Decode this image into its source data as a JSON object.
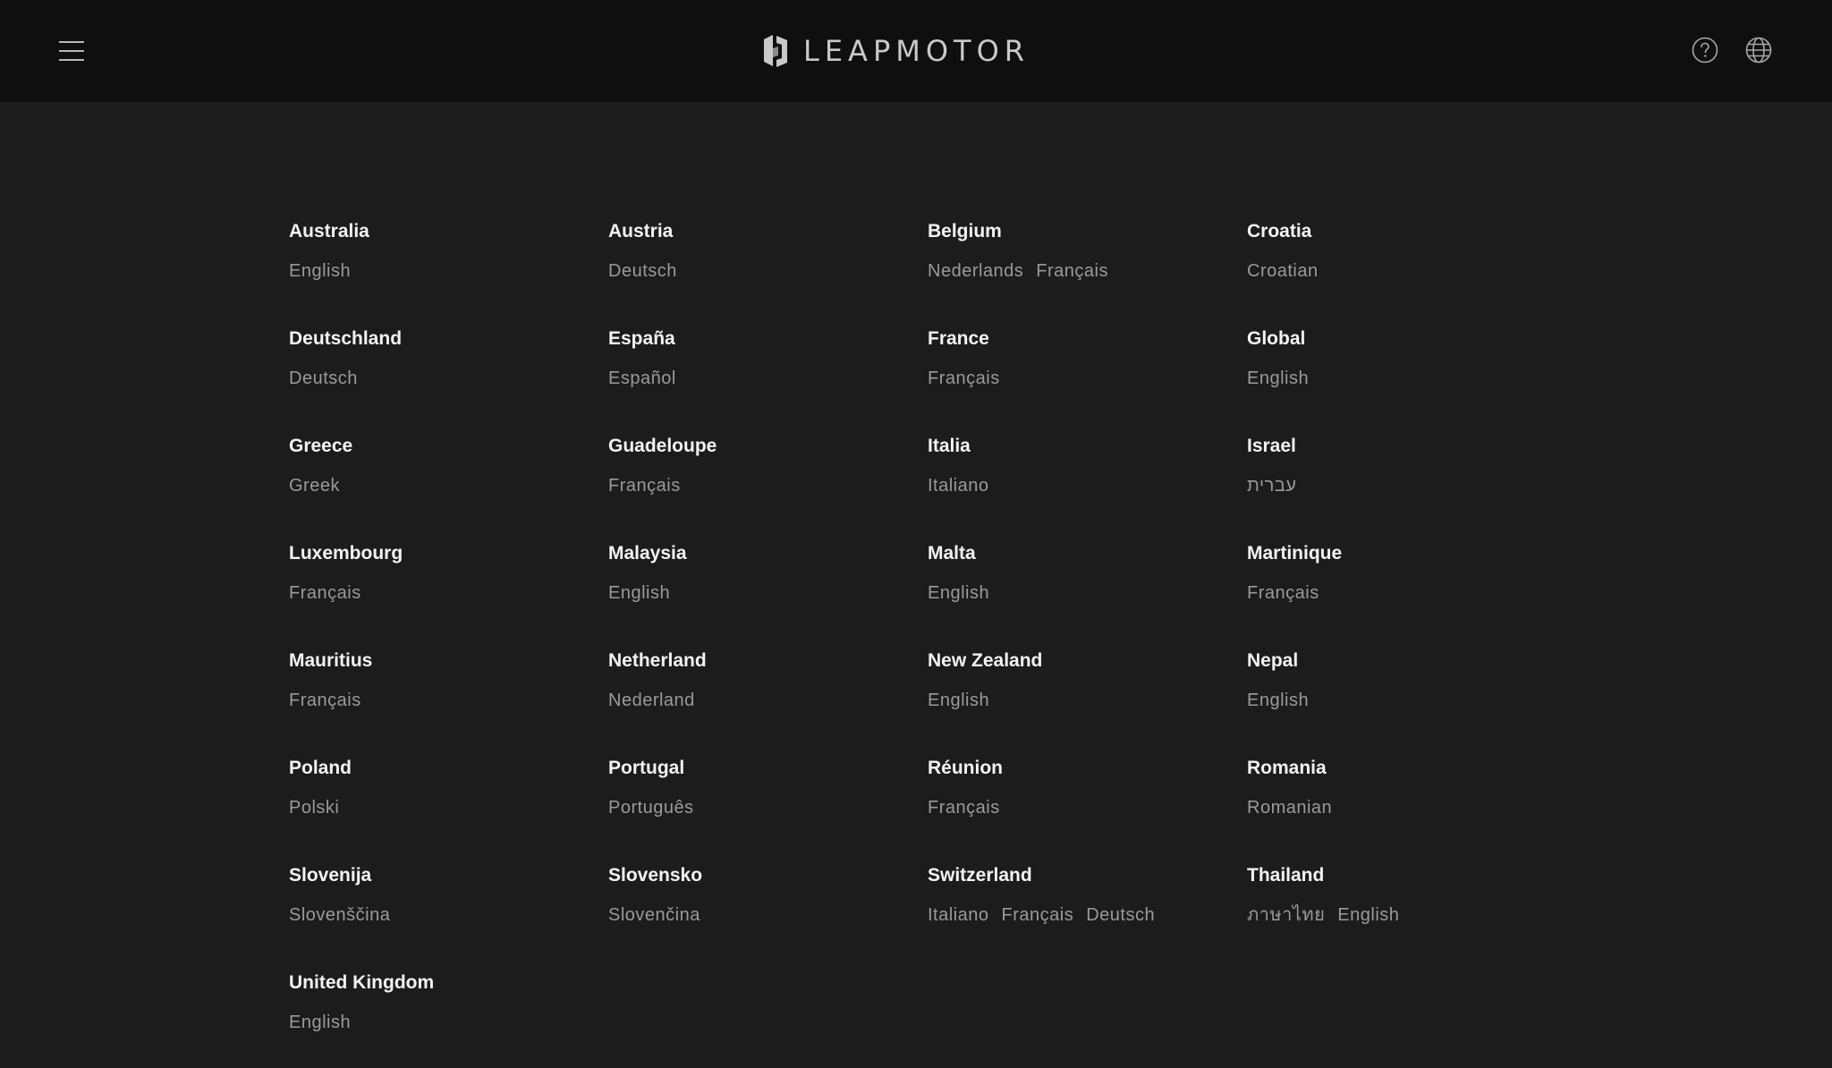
{
  "header": {
    "brand": "LEAPMOTOR",
    "menu_icon": "hamburger-menu-icon",
    "help_icon": "question-circle-icon",
    "language_icon": "globe-icon"
  },
  "colors": {
    "header_bg": "#0f0f0f",
    "page_bg": "#1c1c1c",
    "country_text": "#f4f4f4",
    "language_text": "#9a9a9a"
  },
  "regions": [
    {
      "country": "Australia",
      "languages": [
        "English"
      ]
    },
    {
      "country": "Austria",
      "languages": [
        "Deutsch"
      ]
    },
    {
      "country": "Belgium",
      "languages": [
        "Nederlands",
        "Français"
      ]
    },
    {
      "country": "Croatia",
      "languages": [
        "Croatian"
      ]
    },
    {
      "country": "Deutschland",
      "languages": [
        "Deutsch"
      ]
    },
    {
      "country": "España",
      "languages": [
        "Español"
      ]
    },
    {
      "country": "France",
      "languages": [
        "Français"
      ]
    },
    {
      "country": "Global",
      "languages": [
        "English"
      ]
    },
    {
      "country": "Greece",
      "languages": [
        "Greek"
      ]
    },
    {
      "country": "Guadeloupe",
      "languages": [
        "Français"
      ]
    },
    {
      "country": "Italia",
      "languages": [
        "Italiano"
      ]
    },
    {
      "country": "Israel",
      "languages": [
        "עברית"
      ]
    },
    {
      "country": "Luxembourg",
      "languages": [
        "Français"
      ]
    },
    {
      "country": "Malaysia",
      "languages": [
        "English"
      ]
    },
    {
      "country": "Malta",
      "languages": [
        "English"
      ]
    },
    {
      "country": "Martinique",
      "languages": [
        "Français"
      ]
    },
    {
      "country": "Mauritius",
      "languages": [
        "Français"
      ]
    },
    {
      "country": "Netherland",
      "languages": [
        "Nederland"
      ]
    },
    {
      "country": "New Zealand",
      "languages": [
        "English"
      ]
    },
    {
      "country": "Nepal",
      "languages": [
        "English"
      ]
    },
    {
      "country": "Poland",
      "languages": [
        "Polski"
      ]
    },
    {
      "country": "Portugal",
      "languages": [
        "Português"
      ]
    },
    {
      "country": "Réunion",
      "languages": [
        "Français"
      ]
    },
    {
      "country": "Romania",
      "languages": [
        "Romanian"
      ]
    },
    {
      "country": "Slovenija",
      "languages": [
        "Slovenščina"
      ]
    },
    {
      "country": "Slovensko",
      "languages": [
        "Slovenčina"
      ]
    },
    {
      "country": "Switzerland",
      "languages": [
        "Italiano",
        "Français",
        "Deutsch"
      ]
    },
    {
      "country": "Thailand",
      "languages": [
        "ภาษาไทย",
        "English"
      ]
    },
    {
      "country": "United Kingdom",
      "languages": [
        "English"
      ]
    }
  ]
}
